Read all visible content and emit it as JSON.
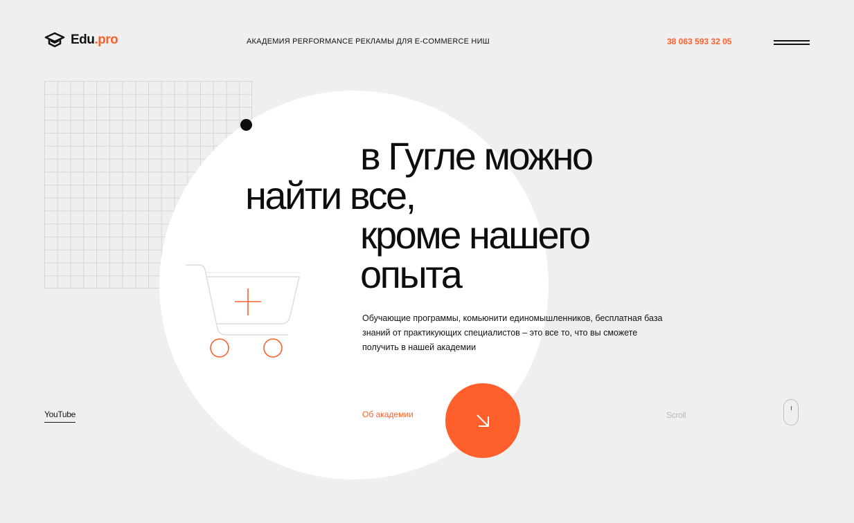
{
  "header": {
    "logo_main": "Edu",
    "logo_dot": ".",
    "logo_suffix": "pro",
    "tagline": "АКАДЕМИЯ PERFORMANCE РЕКЛАМЫ ДЛЯ E-COMMERCE НИШ",
    "phone": "38 063 593 32 05",
    "menu_icon": "hamburger-icon"
  },
  "hero": {
    "headline_lines": [
      "в Гугле можно",
      "найти все,",
      "кроме нашего",
      "опыта"
    ],
    "description": "Обучающие программы, комьюнити единомышленников, бесплатная база знаний от практикующих специалистов – это все то, что вы сможете получить в нашей академии",
    "illustration_icon": "shopping-cart-icon"
  },
  "footer_row": {
    "youtube_label": "YouTube",
    "about_label": "Об академии",
    "cta_icon": "arrow-down-right-icon",
    "scroll_label": "Scroll",
    "scroll_icon": "mouse-icon"
  },
  "colors": {
    "accent": "#ff5f2a",
    "background": "#efefef",
    "circle": "#ffffff",
    "text": "#111111"
  }
}
